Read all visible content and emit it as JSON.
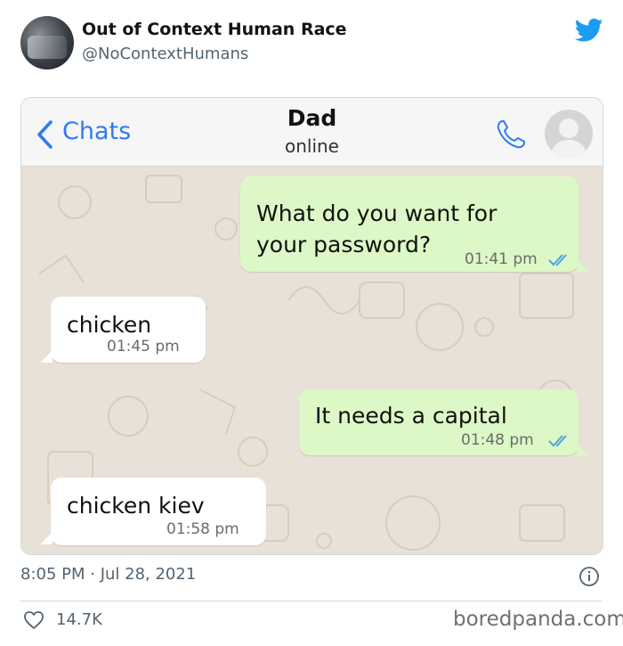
{
  "tweet": {
    "account_name": "Out of Context Human Race",
    "handle": "@NoContextHumans",
    "date": "8:05 PM · Jul 28, 2021",
    "likes": "14.7K"
  },
  "chat": {
    "back_label": "Chats",
    "contact_name": "Dad",
    "status": "online",
    "messages": [
      {
        "direction": "outgoing",
        "line1": "What do you want for",
        "line2": "your password?",
        "time": "01:41 pm"
      },
      {
        "direction": "incoming",
        "line1": "chicken",
        "time": "01:45 pm"
      },
      {
        "direction": "outgoing",
        "line1": "It needs a capital",
        "time": "01:48 pm"
      },
      {
        "direction": "incoming",
        "line1": "chicken kiev",
        "time": "01:58 pm"
      }
    ]
  },
  "watermark": "boredpanda.com",
  "colors": {
    "twitter_blue": "#1d9bf0",
    "ios_blue": "#2f7bf5",
    "outgoing_bubble": "#dcf8c6",
    "incoming_bubble": "#ffffff",
    "chat_background": "#e8e1d7",
    "read_ticks": "#4fa3e0"
  },
  "icons": [
    "twitter-bird-icon",
    "chevron-left-icon",
    "phone-icon",
    "contact-placeholder-icon",
    "double-check-icon",
    "info-icon",
    "heart-icon"
  ]
}
